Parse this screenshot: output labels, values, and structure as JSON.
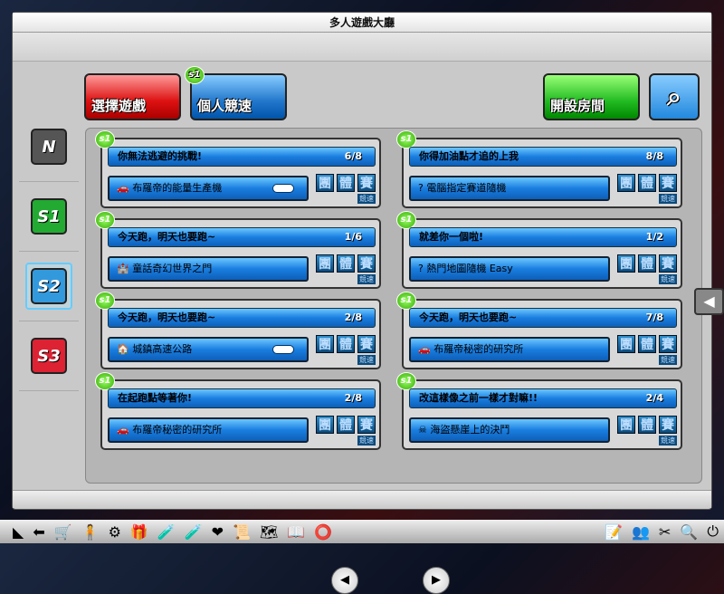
{
  "window": {
    "title": "多人遊戲大廳"
  },
  "sidebar": {
    "items": [
      {
        "label": "N",
        "color": "#555555"
      },
      {
        "label": "S1",
        "color": "#22aa33"
      },
      {
        "label": "S2",
        "color": "#3399dd"
      },
      {
        "label": "S3",
        "color": "#dd2233"
      }
    ]
  },
  "toolbar": {
    "select_game": "選擇遊戲",
    "personal_race": "個人競速",
    "create_room": "開設房間",
    "search_icon": "search-icon",
    "badge": "s1"
  },
  "rooms": [
    {
      "name": "你無法逃避的挑戰!",
      "count": "6/8",
      "map": "布羅帝的能量生產機",
      "icon": "🚗",
      "locked": true
    },
    {
      "name": "你得加油點才追的上我",
      "count": "8/8",
      "map": "電腦指定賽道隨機",
      "icon": "?",
      "locked": false
    },
    {
      "name": "今天跑，明天也要跑~",
      "count": "1/6",
      "map": "童話奇幻世界之門",
      "icon": "🏰",
      "locked": false
    },
    {
      "name": "就差你一個啦!",
      "count": "1/2",
      "map": "熱門地圖隨機 Easy",
      "icon": "?",
      "locked": false
    },
    {
      "name": "今天跑，明天也要跑~",
      "count": "2/8",
      "map": "城鎮高速公路",
      "icon": "🏠",
      "locked": true
    },
    {
      "name": "今天跑，明天也要跑~",
      "count": "7/8",
      "map": "布羅帝秘密的研究所",
      "icon": "🚗",
      "locked": false
    },
    {
      "name": "在起跑點等著你!",
      "count": "2/8",
      "map": "布羅帝秘密的研究所",
      "icon": "🚗",
      "locked": false
    },
    {
      "name": "改這樣像之前一樣才對嘛!!",
      "count": "2/4",
      "map": "海盜懸崖上的決鬥",
      "icon": "☠",
      "locked": false
    }
  ],
  "mode": {
    "chars": [
      "團",
      "體",
      "賽"
    ],
    "speed": "競速"
  },
  "pagination": {
    "prev": "◀",
    "next": "▶"
  }
}
